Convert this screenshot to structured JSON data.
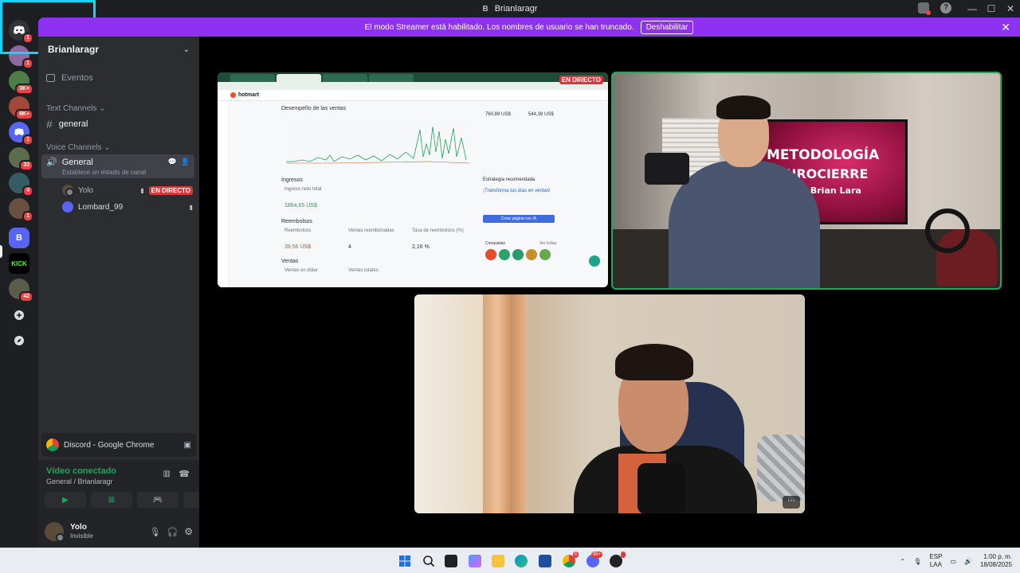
{
  "window": {
    "title": "Brianlaragr",
    "title_initial": "B",
    "minimize": "—",
    "maximize": "☐",
    "close": "✕"
  },
  "banner": {
    "message": "El modo Streamer está habilitado. Los nombres de usuario se han truncado.",
    "button": "Deshabilitar",
    "close": "✕"
  },
  "servers": [
    {
      "icon": "discord-home-icon",
      "badge": "1",
      "color": "#313338"
    },
    {
      "icon": "server-avatar-icon",
      "badge": "1",
      "color": "#8d6a9f"
    },
    {
      "icon": "server-avatar-icon",
      "badge": "3K+",
      "color": "#4f7d4a"
    },
    {
      "icon": "server-avatar-icon",
      "badge": "9K+",
      "color": "#a3463c"
    },
    {
      "icon": "discord-server-icon",
      "badge": "1",
      "color": "#5865f2"
    },
    {
      "icon": "server-avatar-icon",
      "badge": "33",
      "color": "#5b6d4c"
    },
    {
      "icon": "server-avatar-icon",
      "badge": "4",
      "color": "#355c63"
    },
    {
      "icon": "server-avatar-icon",
      "badge": "1",
      "color": "#6a5040"
    },
    {
      "icon": "server-b-icon",
      "label": "B",
      "badge": "",
      "color": "#5865f2"
    },
    {
      "icon": "kick-icon",
      "label": "KICK",
      "badge": "",
      "color": "#000000"
    },
    {
      "icon": "server-avatar-icon",
      "badge": "42",
      "color": "#5b5b4a"
    }
  ],
  "sidebar": {
    "server_name": "Brianlaragr",
    "events": "Eventos",
    "text_category": "Text Channels",
    "text_channel": "general",
    "voice_category": "Voice Channels",
    "voice_channel": "General",
    "voice_status_hint": "Establece un estado de canal",
    "members": [
      {
        "name": "Yolo",
        "live": "EN DIRECTO"
      },
      {
        "name": "Lombard_99"
      }
    ]
  },
  "app_panel": {
    "label": "Discord - Google Chrome"
  },
  "connection": {
    "status": "Vídeo conectado",
    "location": "General / Brianlaragr"
  },
  "user": {
    "name": "Yolo",
    "status": "Invisible"
  },
  "screenshare": {
    "live_label": "EN DIRECTO",
    "brand": "hotmart",
    "chart_title": "Desempeño de las ventas",
    "ingresos": "Ingresos",
    "ingreso_neto": "Ingreso neto total",
    "ingreso_valor": "1864,65 US$",
    "reembolsos": "Reembolsos",
    "reembolsos_col1": "Reembolsos",
    "reembolsos_col2": "Ventas reembolsadas",
    "reembolsos_col3": "Tasa de reembolsos (%)",
    "reembolso_valor": "39,56 US$",
    "reembolso_ventas": "4",
    "reembolso_tasa": "2,16 %",
    "ventas": "Ventas",
    "ventas_col1": "Ventas en dólar",
    "ventas_col2": "Ventas totales",
    "saldo1": "760,89 US$",
    "saldo2": "544,39 US$",
    "estrategia": "Estrategia recomendada",
    "estrategia_texto": "¡Transforma tus días en ventas!",
    "cta": "Crear página con IA",
    "conquistas": "Conquistas",
    "ver_todas": "Ver todas"
  },
  "webcam": {
    "tv_line1": "METODOLOGÍA",
    "tv_line2": "NEUROCIERRE",
    "tv_line3": "Por Brian Lara"
  },
  "tile3": {
    "more": "⋯"
  },
  "taskbar": {
    "lang1": "ESP",
    "lang2": "LAA",
    "time": "1:00 p. m.",
    "date": "18/08/2025"
  }
}
